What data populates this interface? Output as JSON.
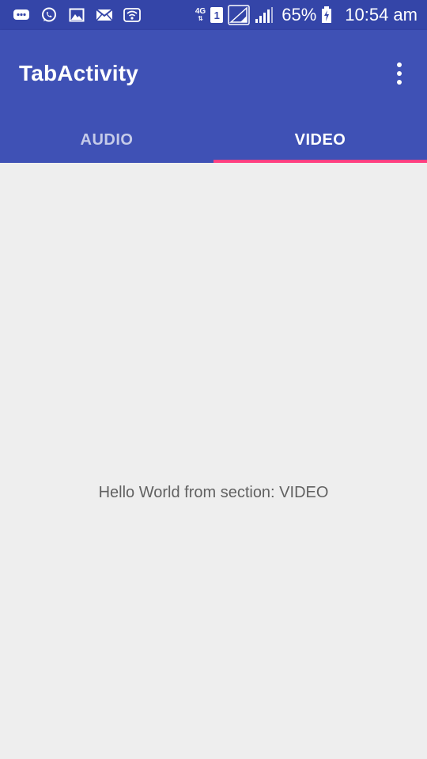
{
  "status_bar": {
    "network_label": "4G",
    "sim_slot": "1",
    "battery_percent": "65%",
    "time": "10:54 am",
    "icons": [
      "messages-icon",
      "whatsapp-icon",
      "gallery-icon",
      "email-icon",
      "wifi-icon",
      "signal-icon",
      "battery-charging-icon"
    ]
  },
  "toolbar": {
    "title": "TabActivity",
    "overflow_icon": "more-vert-icon"
  },
  "tabs": [
    {
      "label": "AUDIO",
      "selected": false
    },
    {
      "label": "VIDEO",
      "selected": true
    }
  ],
  "content": {
    "section_text": "Hello World from section: VIDEO"
  },
  "colors": {
    "status_bar": "#3445a8",
    "primary": "#3f51b5",
    "accent": "#ff4081",
    "background": "#eeeeee",
    "text_secondary": "#616161"
  }
}
